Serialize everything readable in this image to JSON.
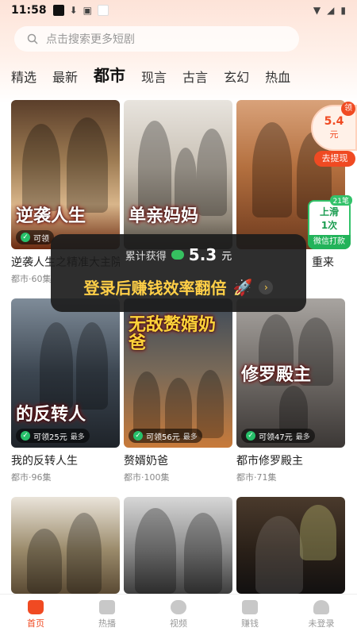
{
  "status": {
    "time": "11:58"
  },
  "search": {
    "placeholder": "点击搜索更多短剧"
  },
  "tabs": [
    {
      "label": "精选",
      "active": false
    },
    {
      "label": "最新",
      "active": false
    },
    {
      "label": "都市",
      "active": true
    },
    {
      "label": "现言",
      "active": false
    },
    {
      "label": "古言",
      "active": false
    },
    {
      "label": "玄幻",
      "active": false
    },
    {
      "label": "热血",
      "active": false
    }
  ],
  "cards": [
    {
      "title": "逆袭人生之精准大主院",
      "poster_text": "逆袭人生",
      "meta": "都市·60集",
      "reward": "可领",
      "reward_sub": ""
    },
    {
      "title": "",
      "poster_text": "单亲妈妈",
      "meta": "",
      "reward": "",
      "reward_sub": ""
    },
    {
      "title": "重来",
      "poster_text": "",
      "meta": "",
      "reward": "",
      "reward_sub": ""
    },
    {
      "title": "我的反转人生",
      "poster_text": "的反转人",
      "meta": "都市·96集",
      "reward": "可领25元",
      "reward_sub": "最多"
    },
    {
      "title": "赘婿奶爸",
      "poster_text": "无敌赘婿奶爸",
      "meta": "都市·100集",
      "reward": "可领56元",
      "reward_sub": "最多"
    },
    {
      "title": "都市修罗殿主",
      "poster_text": "修罗殿主",
      "meta": "都市·71集",
      "reward": "可领47元",
      "reward_sub": "最多"
    },
    {
      "title": "",
      "poster_text": "",
      "meta": "",
      "reward": "",
      "reward_sub": ""
    },
    {
      "title": "",
      "poster_text": "",
      "meta": "",
      "reward": "",
      "reward_sub": ""
    },
    {
      "title": "",
      "poster_text": "",
      "meta": "",
      "reward": "",
      "reward_sub": ""
    }
  ],
  "coin_widget": {
    "badge": "领",
    "amount": "5.4",
    "unit": "元",
    "button": "去提现"
  },
  "swipe_widget": {
    "badge": "21笔",
    "line1": "上滑",
    "line2": "1次",
    "footer": "微信打款"
  },
  "popup": {
    "label": "累计获得",
    "amount": "5.3",
    "unit": "元",
    "cta": "登录后赚钱效率翻倍"
  },
  "nav": [
    {
      "label": "首页",
      "icon": "home-icon",
      "active": true
    },
    {
      "label": "热播",
      "icon": "play-icon",
      "active": false
    },
    {
      "label": "视频",
      "icon": "video-icon",
      "active": false
    },
    {
      "label": "赚钱",
      "icon": "money-icon",
      "active": false
    },
    {
      "label": "未登录",
      "icon": "user-icon",
      "active": false
    }
  ]
}
